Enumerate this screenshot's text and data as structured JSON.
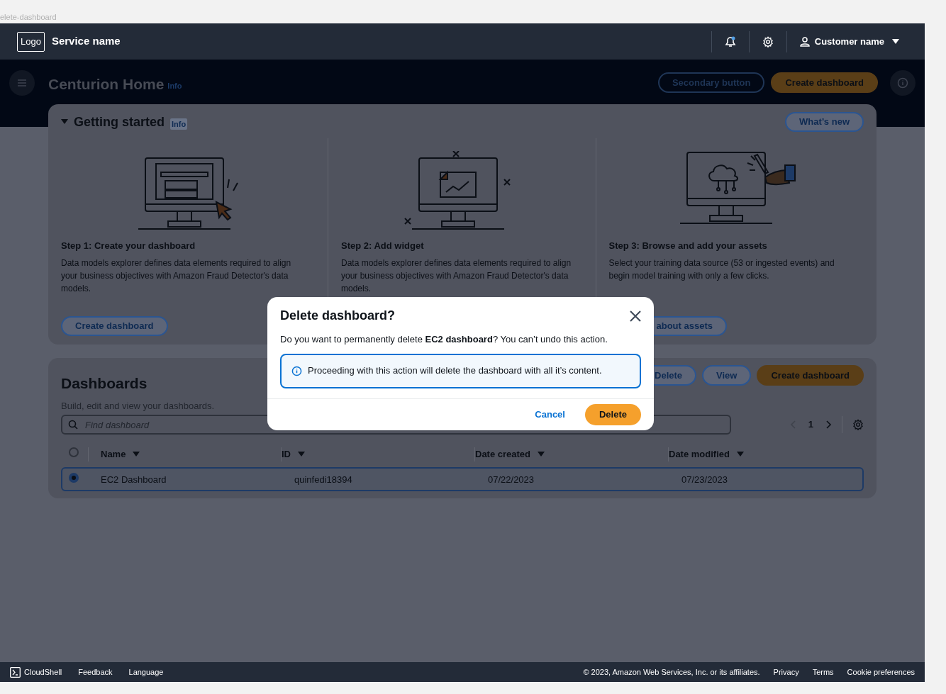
{
  "browser_tab": "elete-dashboard",
  "top_nav": {
    "logo": "Logo",
    "service": "Service name",
    "notifications_unread": true,
    "user": "Customer name"
  },
  "header": {
    "title": "Centurion Home",
    "info": "Info",
    "buttons": [
      {
        "label": "Secondary button",
        "kind": "secondary"
      },
      {
        "label": "Create dashboard",
        "kind": "primary"
      }
    ]
  },
  "getting_started": {
    "expanded": true,
    "title": "Getting started",
    "info": "Info",
    "button": "What’s new",
    "steps": [
      {
        "kind": "form",
        "title": "Step 1: Create your dashboard",
        "text": "Data models explorer defines data elements required to align your business objectives with Amazon Fraud Detector's data models.",
        "button": "Create dashboard"
      },
      {
        "kind": "chart",
        "title": "Step 2: Add widget",
        "text": "Data models explorer defines data elements required to align your business objectives with Amazon Fraud Detector's data models."
      },
      {
        "kind": "cloud",
        "title": "Step 3: Browse and add your assets",
        "text": "Select your training data source (53 or ingested events) and begin model training with only a few clicks.",
        "button": "about assets"
      }
    ]
  },
  "dashboards": {
    "title": "Dashboards",
    "description": "Build, edit and view your dashboards.",
    "actions": [
      {
        "label": "Delete",
        "kind": "normal"
      },
      {
        "label": "View",
        "kind": "normal"
      },
      {
        "label": "Create dashboard",
        "kind": "primary"
      }
    ],
    "search_placeholder": "Find dashboard",
    "page": "1",
    "all_selected": false,
    "columns": [
      "Name",
      "ID",
      "Date created",
      "Date modified"
    ],
    "rows": [
      {
        "selected": true,
        "cells": [
          "EC2 Dashboard",
          "quinfedi18394",
          "07/22/2023",
          "07/23/2023"
        ]
      }
    ]
  },
  "modal": {
    "title": "Delete dashboard?",
    "message": "Do you want to permanently delete **EC2 dashboard**? You can’t undo this action.",
    "alert": "Proceeding with this action will delete the dashboard with all it’s content.",
    "buttons": [
      {
        "label": "Cancel",
        "kind": "link"
      },
      {
        "label": "Delete",
        "kind": "primary"
      }
    ]
  },
  "footer": {
    "left": [
      "CloudShell",
      "Feedback",
      "Language"
    ],
    "right": [
      "© 2023, Amazon Web Services, Inc. or its affiliates.",
      "Privacy",
      "Terms",
      "Cookie preferences"
    ]
  }
}
